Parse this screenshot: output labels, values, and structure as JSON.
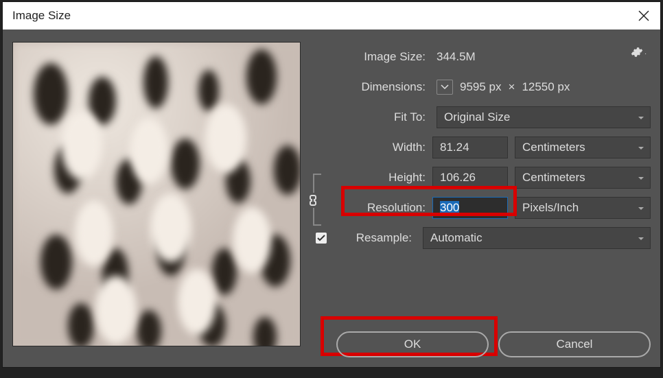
{
  "titlebar": {
    "title": "Image Size"
  },
  "labels": {
    "image_size": "Image Size:",
    "dimensions": "Dimensions:",
    "fit_to": "Fit To:",
    "width": "Width:",
    "height": "Height:",
    "resolution": "Resolution:",
    "resample": "Resample:"
  },
  "values": {
    "image_size": "344.5M",
    "dim_w": "9595 px",
    "dim_h": "12550 px",
    "dim_sep": "×",
    "fit_to": "Original Size",
    "width": "81.24",
    "height": "106.26",
    "resolution": "300",
    "unit_wh": "Centimeters",
    "unit_res": "Pixels/Inch",
    "resample": "Automatic",
    "resample_checked": true
  },
  "buttons": {
    "ok": "OK",
    "cancel": "Cancel"
  }
}
